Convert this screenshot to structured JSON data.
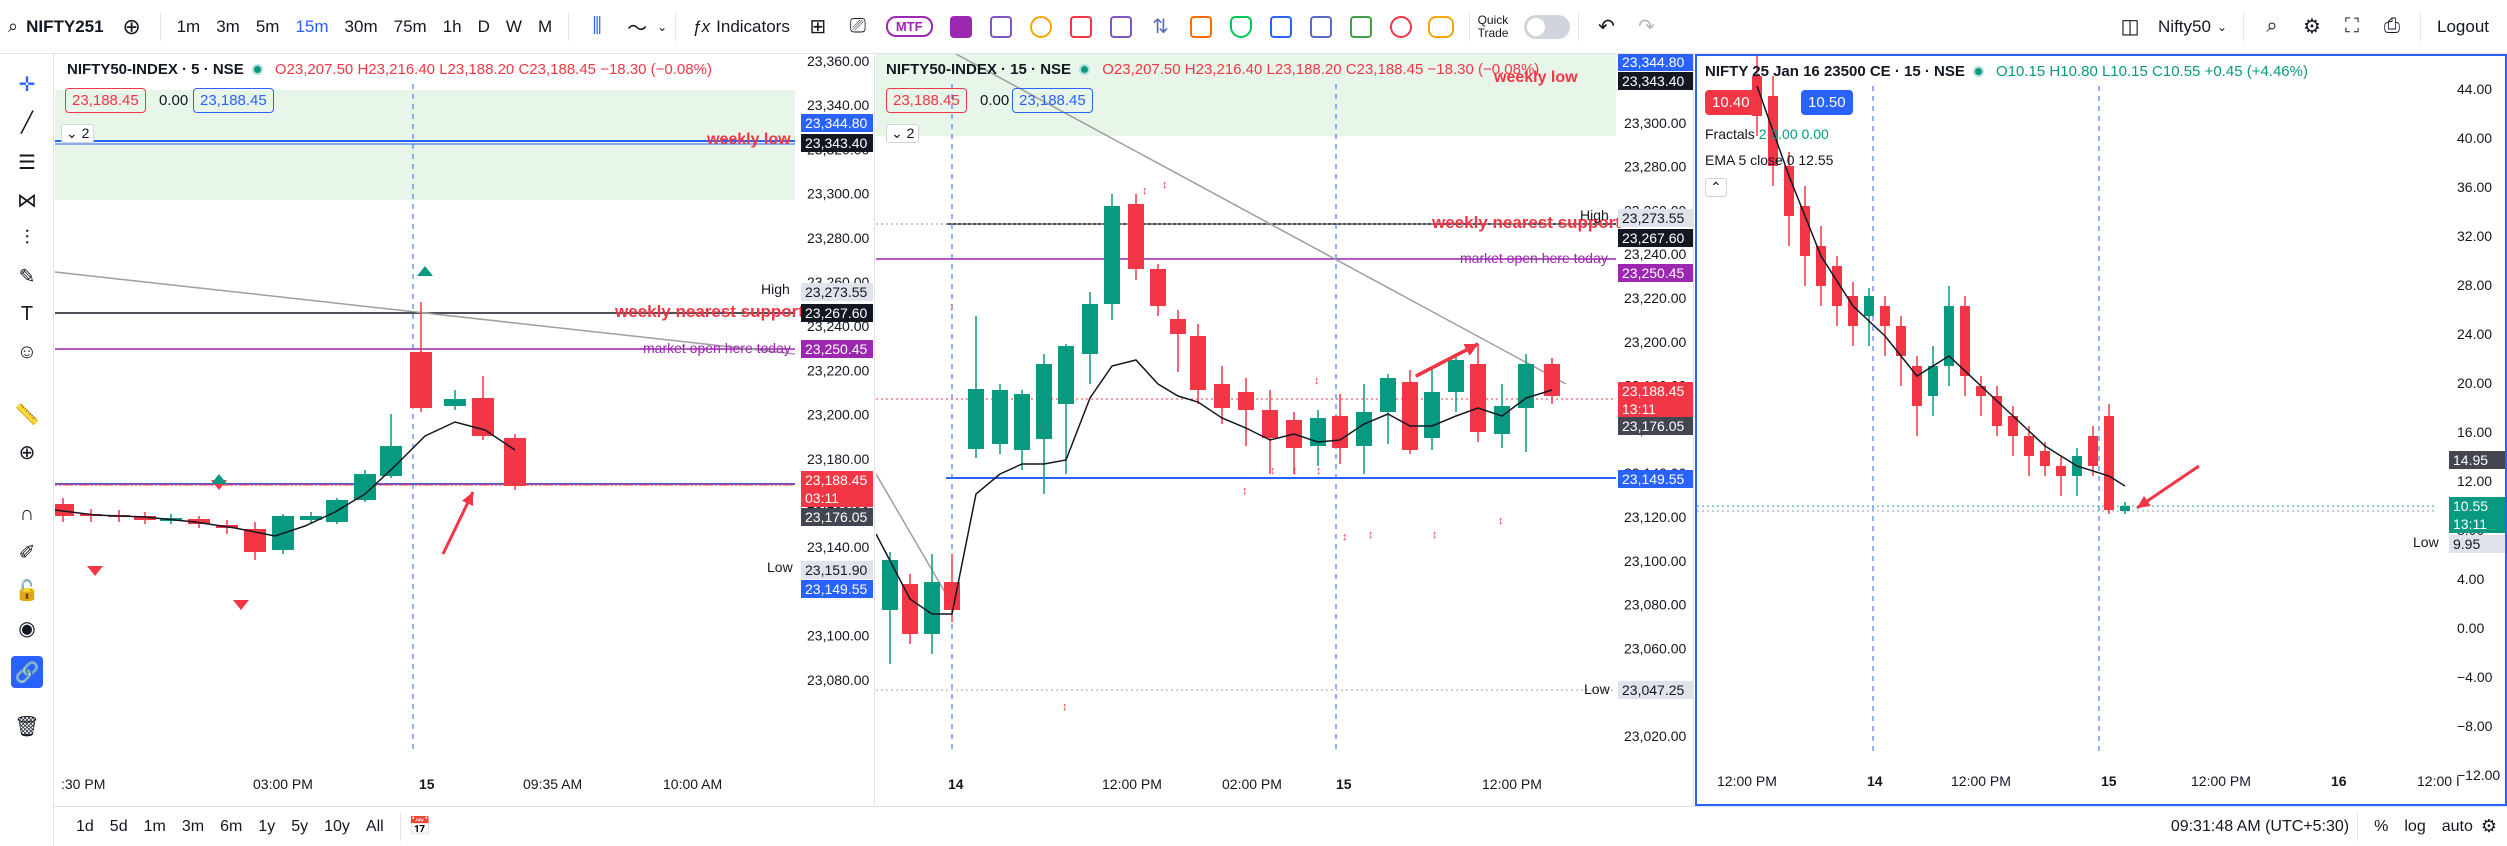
{
  "topbar": {
    "symbol": "NIFTY251",
    "intervals": [
      "1m",
      "3m",
      "5m",
      "15m",
      "30m",
      "75m",
      "1h",
      "D",
      "W",
      "M"
    ],
    "active_interval": "15m",
    "indicators_label": "Indicators",
    "mtf_label": "MTF",
    "quick_trade_label": "Quick Trade",
    "layout_label": "Nifty50",
    "logout_label": "Logout"
  },
  "bottombar": {
    "ranges": [
      "1d",
      "5d",
      "1m",
      "3m",
      "6m",
      "1y",
      "5y",
      "10y",
      "All"
    ],
    "clock": "09:31:48 AM (UTC+5:30)",
    "percent_label": "%",
    "log_label": "log",
    "auto_label": "auto"
  },
  "pane1": {
    "symbol": "NIFTY50-INDEX · 5 · NSE",
    "o": "O23,207.50",
    "h": "H23,216.40",
    "l": "L23,188.20",
    "c": "C23,188.45",
    "chg": "−18.30 (−0.08%)",
    "sell": "23,188.45",
    "spread": "0.00",
    "buy": "23,188.45",
    "collapse": "2",
    "annot_support": "weekly nearest support",
    "annot_open": "market open here today",
    "annot_weekly_low": "weekly low",
    "price_axis": [
      "23,360.00",
      "23,340.00",
      "23,320.00",
      "23,300.00",
      "23,280.00",
      "23,260.00",
      "23,240.00",
      "23,220.00",
      "23,200.00",
      "23,180.00",
      "23,160.00",
      "23,140.00",
      "23,120.00",
      "23,100.00",
      "23,080.00"
    ],
    "tags": {
      "t1": "23,344.80",
      "t2": "23,343.40",
      "high_lbl": "High",
      "t3": "23,273.55",
      "t4": "23,267.60",
      "t5": "23,250.45",
      "t6": "23,188.45",
      "t6b": "03:11",
      "t7": "23,176.05",
      "low_lbl": "Low",
      "t8": "23,151.90",
      "t9": "23,149.55"
    },
    "time_axis": [
      ":30 PM",
      "03:00 PM",
      "15",
      "09:35 AM",
      "10:00 AM"
    ]
  },
  "pane2": {
    "symbol": "NIFTY50-INDEX · 15 · NSE",
    "o": "O23,207.50",
    "h": "H23,216.40",
    "l": "L23,188.20",
    "c": "C23,188.45",
    "chg": "−18.30 (−0.08%)",
    "sell": "23,188.45",
    "spread": "0.00",
    "buy": "23,188.45",
    "collapse": "2",
    "annot_support": "weekly nearest support",
    "annot_open": "market open here today",
    "annot_weekly_low": "weekly low",
    "price_axis": [
      "23,320.00",
      "23,300.00",
      "23,280.00",
      "23,260.00",
      "23,240.00",
      "23,220.00",
      "23,200.00",
      "23,180.00",
      "23,160.00",
      "23,140.00",
      "23,120.00",
      "23,100.00",
      "23,080.00",
      "23,060.00",
      "23,040.00",
      "23,020.00"
    ],
    "tags": {
      "t1": "23,344.80",
      "t2": "23,343.40",
      "high_lbl": "High",
      "t3": "23,273.55",
      "t4": "23,267.60",
      "t5": "23,250.45",
      "t6": "23,188.45",
      "t6b": "13:11",
      "t7": "23,176.05",
      "t8": "23,149.55",
      "low_lbl": "Low",
      "t9": "23,047.25"
    },
    "time_axis": [
      "14",
      "12:00 PM",
      "02:00 PM",
      "15",
      "12:00 PM"
    ]
  },
  "pane3": {
    "symbol": "NIFTY 25 Jan 16 23500 CE · 15 · NSE",
    "o": "O10.15",
    "h": "H10.80",
    "l": "L10.15",
    "c": "C10.55",
    "chg": "+0.45 (+4.46%)",
    "sell": "10.40",
    "buy": "10.50",
    "fractals_label": "Fractals",
    "fractals_v1": "2 0.00",
    "fractals_v2": "0.00",
    "ema_label": "EMA 5 close 0",
    "ema_val": "12.55",
    "price_axis": [
      "44.00",
      "40.00",
      "36.00",
      "32.00",
      "28.00",
      "24.00",
      "20.00",
      "16.00",
      "12.00",
      "8.00",
      "4.00",
      "0.00",
      "−4.00",
      "−8.00",
      "−12.00"
    ],
    "tags": {
      "t1": "14.95",
      "t2": "10.55",
      "t2b": "13:11",
      "low_lbl": "Low",
      "t3": "9.95"
    },
    "time_axis": [
      "12:00 PM",
      "14",
      "12:00 PM",
      "15",
      "12:00 PM",
      "16",
      "12:00 I"
    ]
  },
  "colors": {
    "up": "#089981",
    "down": "#f23645",
    "accent": "#2962ff",
    "purple": "#9c27b0",
    "zone": "#e8f5e9"
  }
}
